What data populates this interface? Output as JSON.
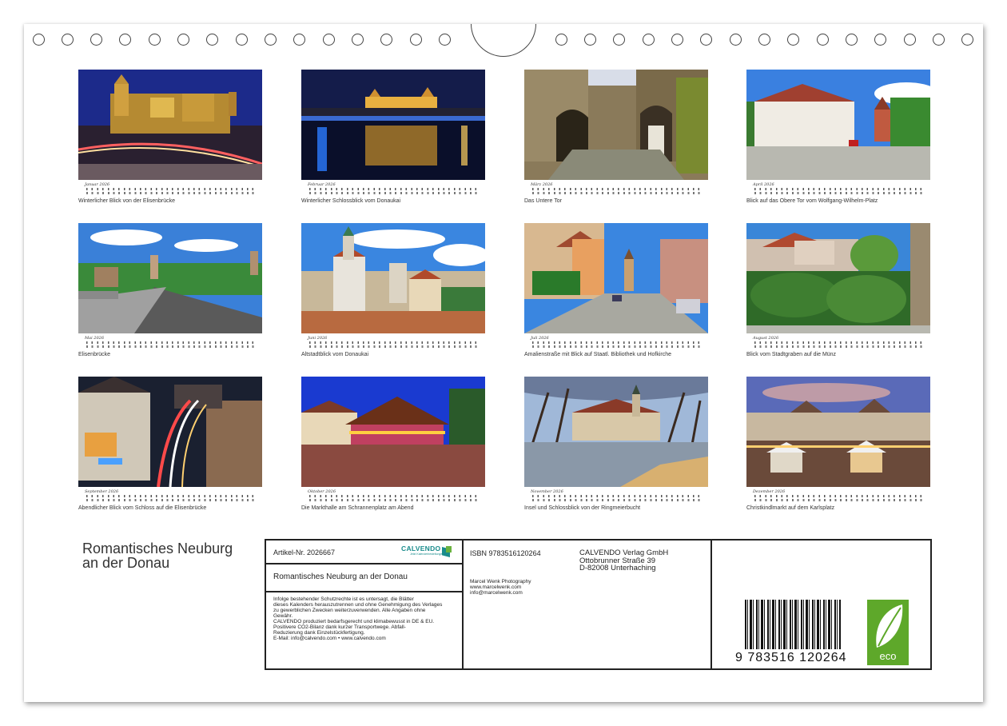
{
  "calendar": {
    "title_line1": "Romantisches Neuburg",
    "title_line2": "an der Donau",
    "months": [
      {
        "month": "Januar 2026",
        "caption": "Winterlicher Blick von der Elisenbrücke",
        "scene": "night-castle"
      },
      {
        "month": "Februar 2026",
        "caption": "Winterlicher Schlossblick vom Donaukai",
        "scene": "night-river"
      },
      {
        "month": "März 2026",
        "caption": "Das Untere Tor",
        "scene": "gate"
      },
      {
        "month": "April 2026",
        "caption": "Blick auf das Obere Tor vom Wolfgang-Wilhelm-Platz",
        "scene": "square"
      },
      {
        "month": "Mai 2026",
        "caption": "Elisenbrücke",
        "scene": "bridge"
      },
      {
        "month": "Juni 2026",
        "caption": "Altstadtblick vom Donaukai",
        "scene": "castle-day"
      },
      {
        "month": "Juli 2026",
        "caption": "Amalienstraße mit Blick auf Staatl. Bibliothek und Hofkirche",
        "scene": "street"
      },
      {
        "month": "August 2026",
        "caption": "Blick vom Stadtgraben auf die Münz",
        "scene": "garden"
      },
      {
        "month": "September 2026",
        "caption": "Abendlicher Blick vom Schloss auf die Elisenbrücke",
        "scene": "night-street"
      },
      {
        "month": "Oktober 2026",
        "caption": "Die Markthalle am Schrannenplatz am Abend",
        "scene": "market-hall"
      },
      {
        "month": "November 2026",
        "caption": "Insel und Schlossblick von der Ringmeierbucht",
        "scene": "pond"
      },
      {
        "month": "Dezember 2026",
        "caption": "Christkindlmarkt auf dem Karlsplatz",
        "scene": "xmas"
      }
    ]
  },
  "info": {
    "article": "Artikel-Nr. 2026667",
    "logo_text": "CALVENDO",
    "logo_sub": "Jetzt Kalenderbestellungen",
    "title_field": "Romantisches Neuburg an der Donau",
    "legal": [
      "Infolge bestehender Schutzrechte ist es untersagt, die Blätter",
      "dieses Kalenders herauszutrennen und ohne Genehmigung des Verlages",
      "zu gewerblichen Zwecken weiterzuverwenden. Alle Angaben ohne",
      "Gewähr.",
      "CALVENDO produziert bedarfsgerecht und klimabewusst in DE & EU.",
      "Positivere CO2-Bilanz dank kurzer Transportwege. Abfall-",
      "Reduzierung dank Einzelstückfertigung.",
      "E-Mail: info@calvendo.com • www.calvendo.com"
    ],
    "isbn": "ISBN 9783516120264",
    "publisher": [
      "CALVENDO Verlag GmbH",
      "Ottobrunner Straße 39",
      "D-82008 Unterhaching"
    ],
    "photographer": [
      "Marcel Wenk Photography",
      "www.marcelwenk.com",
      "info@marcelwenk.com"
    ],
    "barcode_digits": "9  783516  120264",
    "eco_label": "eco"
  },
  "colors": {
    "eco_green": "#5ea82a",
    "logo_teal": "#1a8c8c",
    "logo_green": "#6ab23e"
  }
}
